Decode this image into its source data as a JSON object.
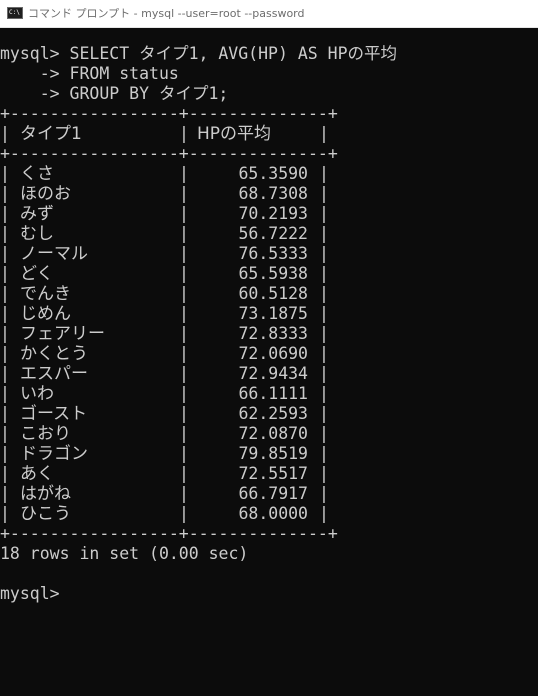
{
  "window": {
    "title": "コマンド プロンプト - mysql  --user=root --password",
    "icon_text": "C:\\"
  },
  "console": {
    "query_lines": [
      "mysql> SELECT タイプ1, AVG(HP) AS HPの平均",
      "    -> FROM status",
      "    -> GROUP BY タイプ1;"
    ],
    "border_line": "+-----------------+--------------+",
    "header": {
      "col1": "タイプ1",
      "col2": "HPの平均"
    },
    "rows": [
      {
        "type": "くさ",
        "hp": "65.3590"
      },
      {
        "type": "ほのお",
        "hp": "68.7308"
      },
      {
        "type": "みず",
        "hp": "70.2193"
      },
      {
        "type": "むし",
        "hp": "56.7222"
      },
      {
        "type": "ノーマル",
        "hp": "76.5333"
      },
      {
        "type": "どく",
        "hp": "65.5938"
      },
      {
        "type": "でんき",
        "hp": "60.5128"
      },
      {
        "type": "じめん",
        "hp": "73.1875"
      },
      {
        "type": "フェアリー",
        "hp": "72.8333"
      },
      {
        "type": "かくとう",
        "hp": "72.0690"
      },
      {
        "type": "エスパー",
        "hp": "72.9434"
      },
      {
        "type": "いわ",
        "hp": "66.1111"
      },
      {
        "type": "ゴースト",
        "hp": "62.2593"
      },
      {
        "type": "こおり",
        "hp": "72.0870"
      },
      {
        "type": "ドラゴン",
        "hp": "79.8519"
      },
      {
        "type": "あく",
        "hp": "72.5517"
      },
      {
        "type": "はがね",
        "hp": "66.7917"
      },
      {
        "type": "ひこう",
        "hp": "68.0000"
      }
    ],
    "result_summary": "18 rows in set (0.00 sec)",
    "prompt": "mysql>",
    "text_color": "#cccccc",
    "background_color": "#0c0c0c"
  }
}
